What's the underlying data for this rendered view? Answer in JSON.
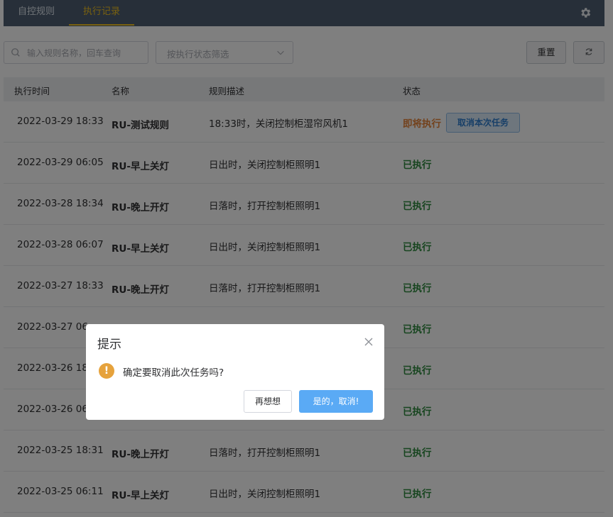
{
  "tabs": [
    {
      "label": "自控规则",
      "active": false
    },
    {
      "label": "执行记录",
      "active": true
    }
  ],
  "toolbar": {
    "search_placeholder": "输入规则名称，回车查询",
    "status_filter_placeholder": "按执行状态筛选",
    "reset_label": "重置"
  },
  "table": {
    "headers": {
      "time": "执行时间",
      "name": "名称",
      "desc": "规则描述",
      "status": "状态"
    },
    "cancel_task_label": "取消本次任务",
    "rows": [
      {
        "time": "2022-03-29 18:33",
        "name": "RU-测试规则",
        "desc": "18:33时，关闭控制柜湿帘风机1",
        "status": "即将执行",
        "pending": true
      },
      {
        "time": "2022-03-29 06:05",
        "name": "RU-早上关灯",
        "desc": "日出时，关闭控制柜照明1",
        "status": "已执行"
      },
      {
        "time": "2022-03-28 18:34",
        "name": "RU-晚上开灯",
        "desc": "日落时，打开控制柜照明1",
        "status": "已执行"
      },
      {
        "time": "2022-03-28 06:07",
        "name": "RU-早上关灯",
        "desc": "日出时，关闭控制柜照明1",
        "status": "已执行"
      },
      {
        "time": "2022-03-27 18:33",
        "name": "RU-晚上开灯",
        "desc": "日落时，打开控制柜照明1",
        "status": "已执行"
      },
      {
        "time": "2022-03-27 06:",
        "name": "",
        "desc": "",
        "status": "已执行"
      },
      {
        "time": "2022-03-26 18:",
        "name": "",
        "desc": "",
        "status": "已执行"
      },
      {
        "time": "2022-03-26 06:",
        "name": "",
        "desc": "",
        "status": "已执行"
      },
      {
        "time": "2022-03-25 18:31",
        "name": "RU-晚上开灯",
        "desc": "日落时，打开控制柜照明1",
        "status": "已执行"
      },
      {
        "time": "2022-03-25 06:11",
        "name": "RU-早上关灯",
        "desc": "日出时，关闭控制柜照明1",
        "status": "已执行"
      }
    ]
  },
  "dialog": {
    "title": "提示",
    "icon": "warning-icon",
    "message": "确定要取消此次任务吗?",
    "cancel_label": "再想想",
    "confirm_label": "是的，取消!"
  },
  "colors": {
    "topbar": "#4e5f73",
    "active_tab": "#f0c020",
    "executed": "#2e8b3e",
    "pending": "#e6853a",
    "primary": "#5aaaf5",
    "warning": "#e6a23c"
  }
}
